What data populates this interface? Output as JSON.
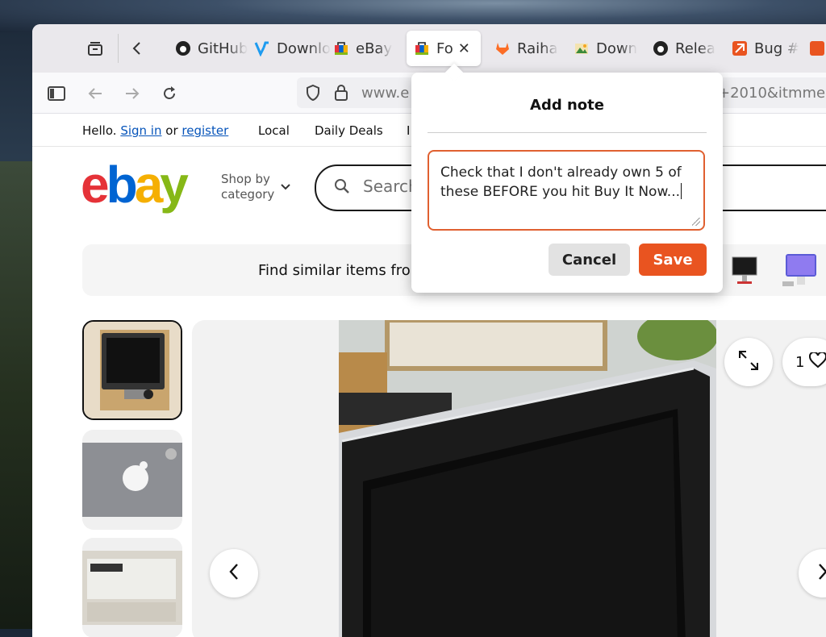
{
  "browser": {
    "tabs": [
      {
        "label": "GitHub",
        "icon": "github-icon"
      },
      {
        "label": "Downloads",
        "icon": "v-logo-icon"
      },
      {
        "label": "eBay",
        "icon": "ebay-bag-icon"
      },
      {
        "label": "Fo",
        "icon": "ebay-bag-icon",
        "active": true
      },
      {
        "label": "Raiha",
        "icon": "gitlab-icon"
      },
      {
        "label": "Down",
        "icon": "image-icon"
      },
      {
        "label": "Relea",
        "icon": "github-icon"
      },
      {
        "label": "Bug #",
        "icon": "ubuntu-launchpad-icon"
      }
    ],
    "url": "www.e",
    "url_tail": "+2010&itmme"
  },
  "ebay": {
    "greeting": "Hello.",
    "sign_in": "Sign in",
    "or": "or",
    "register": "register",
    "nav_local": "Local",
    "nav_daily_deals": "Daily Deals",
    "nav_more": "I",
    "logo": {
      "e": "e",
      "b": "b",
      "a": "a",
      "y": "y"
    },
    "shop_by_line1": "Shop by",
    "shop_by_line2": "category",
    "search_placeholder": "Search",
    "banner_text": "Find similar items from"
  },
  "listing": {
    "watch_count": "1"
  },
  "note_popup": {
    "title": "Add note",
    "note_text": "Check that I don't already own 5 of these BEFORE you hit Buy It Now...",
    "cancel_label": "Cancel",
    "save_label": "Save"
  },
  "colors": {
    "accent": "#e95420",
    "ebay_red": "#e53238",
    "ebay_blue": "#0064d2",
    "ebay_yellow": "#f5af02",
    "ebay_green": "#86b817",
    "link": "#0654ba"
  }
}
